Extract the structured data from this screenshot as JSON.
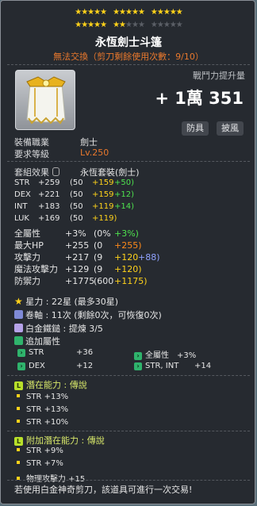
{
  "stars": {
    "filled": 22,
    "max": 30,
    "row1_groups": 3,
    "row2_groups": 3
  },
  "item": {
    "name": "永恆劍士斗篷",
    "trade_note": "無法交換（剪刀剩餘使用次數：9/10）",
    "icon": "cape-icon",
    "combat_power_label": "戰鬥力提升量",
    "combat_power_value": "+ 1萬 351",
    "tags": [
      "防具",
      "披風"
    ]
  },
  "requirements": {
    "job_label": "裝備職業",
    "job_value": "劍士",
    "level_label": "要求等級",
    "level_value": "Lv.250"
  },
  "set": {
    "label": "套組效果",
    "value": "永恆套裝(劍士)"
  },
  "main_stats": [
    {
      "name": "STR",
      "total": "+259",
      "base": "(50",
      "star": "+159",
      "extra": "+50)"
    },
    {
      "name": "DEX",
      "total": "+221",
      "base": "(50",
      "star": "+159",
      "extra": "+12)"
    },
    {
      "name": "INT",
      "total": "+183",
      "base": "(50",
      "star": "+119",
      "extra": "+14)"
    },
    {
      "name": "LUK",
      "total": "+169",
      "base": "(50",
      "star": "+119)",
      "extra": ""
    }
  ],
  "other_stats": [
    {
      "name": "全屬性",
      "total": "+3%",
      "base": "(0%",
      "a": "+3%)",
      "a_color": "grn",
      "b": "",
      "b_color": ""
    },
    {
      "name": "最大HP",
      "total": "+255",
      "base": "(0",
      "a": "+255)",
      "a_color": "org",
      "b": "",
      "b_color": ""
    },
    {
      "name": "攻擊力",
      "total": "+217",
      "base": "(9",
      "a": "+120",
      "a_color": "yel",
      "b": "+88)",
      "b_color": "blu"
    },
    {
      "name": "魔法攻擊力",
      "total": "+129",
      "base": "(9",
      "a": "+120)",
      "a_color": "yel",
      "b": "",
      "b_color": ""
    },
    {
      "name": "防禦力",
      "total": "+1775",
      "base": "(600",
      "a": "+1175)",
      "a_color": "yel",
      "b": "",
      "b_color": ""
    }
  ],
  "upgrade": {
    "star_line": "星力 : 22星 (最多30星)",
    "scroll_line": "卷軸 : 11次 (剩餘0次，可恢復0次)",
    "hammer_line": "白金鐵鎚 : 提煉 3/5",
    "bonus_label": "追加屬性"
  },
  "bonus_stats": [
    {
      "text": "STR",
      "value": "+36"
    },
    {
      "text": "全屬性",
      "value": "+3%"
    },
    {
      "text": "DEX",
      "value": "+12"
    },
    {
      "text": "STR, INT",
      "value": "+14"
    }
  ],
  "potential": {
    "label": "潛在能力 : 傳說",
    "badge": "L",
    "lines": [
      "STR +13%",
      "STR +13%",
      "STR +10%"
    ]
  },
  "additional_potential": {
    "label": "附加潛在能力 : 傳說",
    "badge": "L",
    "lines": [
      "STR +9%",
      "STR +7%",
      "物理攻擊力 +15"
    ]
  },
  "footer": "若使用白金神奇剪刀，該道具可進行一次交易!"
}
